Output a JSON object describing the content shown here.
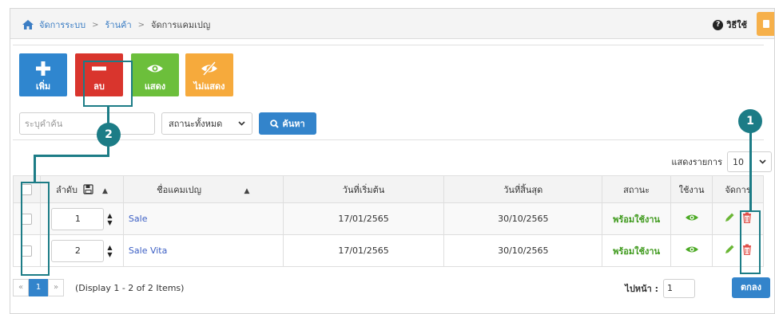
{
  "breadcrumb": {
    "home_label": "จัดการระบบ",
    "shop_label": "ร้านค้า",
    "current_label": "จัดการแคมเปญ"
  },
  "help": {
    "label": "วิธีใช้"
  },
  "toolbar": {
    "add_label": "เพิ่ม",
    "delete_label": "ลบ",
    "show_label": "แสดง",
    "hide_label": "ไม่แสดง"
  },
  "filters": {
    "search_placeholder": "ระบุคำค้น",
    "status_selected": "สถานะทั้งหมด",
    "search_button": "ค้นหา"
  },
  "rows_per_page": {
    "label": "แสดงรายการ",
    "value": "10"
  },
  "table": {
    "headers": {
      "order": "ลำดับ",
      "name": "ชื่อแคมเปญ",
      "start": "วันที่เริ่มต้น",
      "end": "วันที่สิ้นสุด",
      "status": "สถานะ",
      "usage": "ใช้งาน",
      "manage": "จัดการ"
    },
    "rows": [
      {
        "order": "1",
        "name": "Sale",
        "start": "17/01/2565",
        "end": "30/10/2565",
        "status": "พร้อมใช้งาน"
      },
      {
        "order": "2",
        "name": "Sale Vita",
        "start": "17/01/2565",
        "end": "30/10/2565",
        "status": "พร้อมใช้งาน"
      }
    ]
  },
  "pagination": {
    "prev": "«",
    "page": "1",
    "next": "»",
    "info": "(Display 1 - 2 of 2 Items)",
    "goto_label": "ไปหน้า :",
    "goto_value": "1",
    "ok_label": "ตกลง"
  },
  "annotations": {
    "badge1": "1",
    "badge2": "2"
  },
  "colors": {
    "annotation": "#1c7c86",
    "add": "#2f86cf",
    "delete": "#d9352d",
    "show": "#6cbf3b",
    "hide": "#f6aa3c",
    "ready": "#3f9a1d"
  }
}
